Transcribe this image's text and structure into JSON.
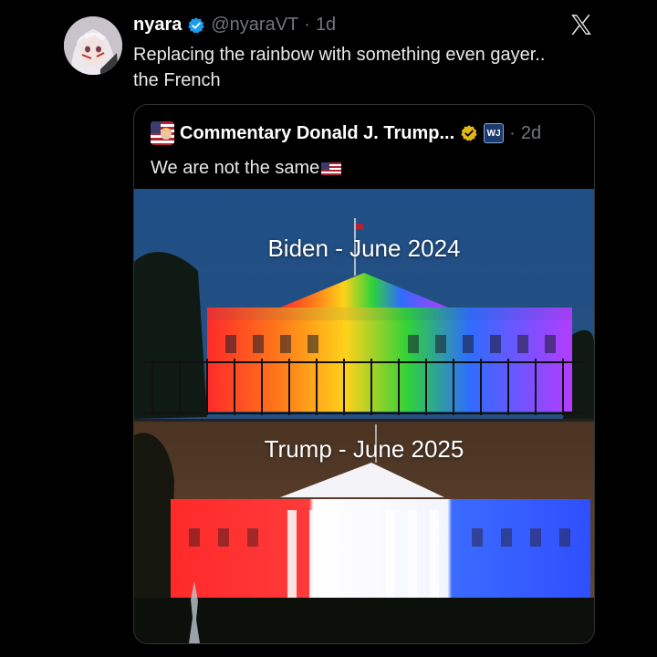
{
  "author": {
    "name": "nyara",
    "handle": "@nyaraVT",
    "separator": "·",
    "time": "1d",
    "text": "Replacing the rainbow with something even gayer..\nthe French"
  },
  "quoted": {
    "name": "Commentary Donald J. Trump...",
    "affiliate": "WJ",
    "separator": "·",
    "time": "2d",
    "text": "We are not the same"
  },
  "photo": {
    "top_caption": "Biden - June 2024",
    "bottom_caption": "Trump - June 2025"
  },
  "colors": {
    "background": "#000000",
    "verified_blue": "#1d9bf0",
    "gold_badge": "#e2b719",
    "muted": "#71767b"
  },
  "icons": {
    "verified": "verified-badge-icon",
    "x_logo": "x-logo-icon",
    "gold": "gold-badge-icon",
    "flag": "us-flag-icon"
  }
}
